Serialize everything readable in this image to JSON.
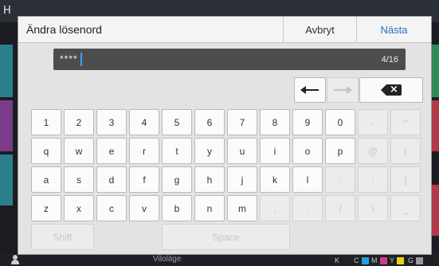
{
  "background": {
    "corner_letter": "H",
    "status_text": "Viloläge",
    "ink_levels": [
      {
        "label": "K",
        "color": "#222222"
      },
      {
        "label": "C",
        "color": "#1fa3d8"
      },
      {
        "label": "M",
        "color": "#d43a8c"
      },
      {
        "label": "Y",
        "color": "#e4d419"
      },
      {
        "label": "G",
        "color": "#9a9a9a"
      }
    ]
  },
  "dialog": {
    "title": "Ändra lösenord",
    "cancel_label": "Avbryt",
    "next_label": "Nästa",
    "password_masked": "****",
    "char_count": "4/16",
    "accent_color": "#2470c2"
  },
  "keyboard": {
    "rows": [
      [
        {
          "label": "1",
          "enabled": true
        },
        {
          "label": "2",
          "enabled": true
        },
        {
          "label": "3",
          "enabled": true
        },
        {
          "label": "4",
          "enabled": true
        },
        {
          "label": "5",
          "enabled": true
        },
        {
          "label": "6",
          "enabled": true
        },
        {
          "label": "7",
          "enabled": true
        },
        {
          "label": "8",
          "enabled": true
        },
        {
          "label": "9",
          "enabled": true
        },
        {
          "label": "0",
          "enabled": true
        },
        {
          "label": "-",
          "enabled": false
        },
        {
          "label": "^",
          "enabled": false
        }
      ],
      [
        {
          "label": "q",
          "enabled": true
        },
        {
          "label": "w",
          "enabled": true
        },
        {
          "label": "e",
          "enabled": true
        },
        {
          "label": "r",
          "enabled": true
        },
        {
          "label": "t",
          "enabled": true
        },
        {
          "label": "y",
          "enabled": true
        },
        {
          "label": "u",
          "enabled": true
        },
        {
          "label": "i",
          "enabled": true
        },
        {
          "label": "o",
          "enabled": true
        },
        {
          "label": "p",
          "enabled": true
        },
        {
          "label": "@",
          "enabled": false
        },
        {
          "label": "[",
          "enabled": false
        }
      ],
      [
        {
          "label": "a",
          "enabled": true
        },
        {
          "label": "s",
          "enabled": true
        },
        {
          "label": "d",
          "enabled": true
        },
        {
          "label": "f",
          "enabled": true
        },
        {
          "label": "g",
          "enabled": true
        },
        {
          "label": "h",
          "enabled": true
        },
        {
          "label": "j",
          "enabled": true
        },
        {
          "label": "k",
          "enabled": true
        },
        {
          "label": "l",
          "enabled": true
        },
        {
          "label": ";",
          "enabled": false
        },
        {
          "label": ":",
          "enabled": false
        },
        {
          "label": "]",
          "enabled": false
        }
      ],
      [
        {
          "label": "z",
          "enabled": true
        },
        {
          "label": "x",
          "enabled": true
        },
        {
          "label": "c",
          "enabled": true
        },
        {
          "label": "v",
          "enabled": true
        },
        {
          "label": "b",
          "enabled": true
        },
        {
          "label": "n",
          "enabled": true
        },
        {
          "label": "m",
          "enabled": true
        },
        {
          "label": ",",
          "enabled": false
        },
        {
          "label": ".",
          "enabled": false
        },
        {
          "label": "/",
          "enabled": false
        },
        {
          "label": "\\",
          "enabled": false
        },
        {
          "label": "_",
          "enabled": false
        }
      ]
    ],
    "shift_label": "Shift",
    "space_label": "Space",
    "cursor_left_icon": "arrow-left-icon",
    "cursor_right_icon": "arrow-right-icon",
    "backspace_icon": "backspace-icon"
  }
}
